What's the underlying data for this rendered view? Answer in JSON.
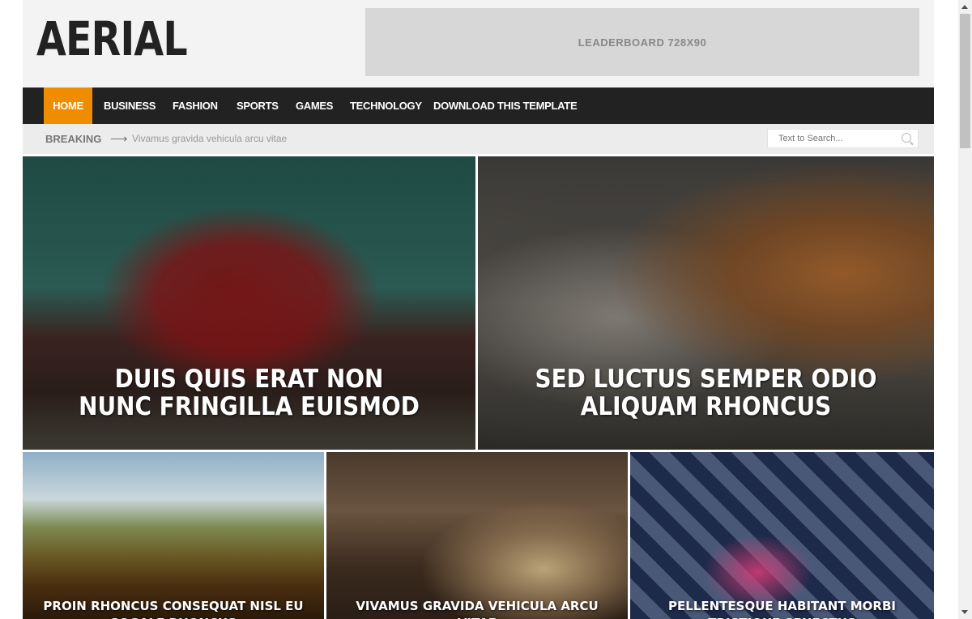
{
  "header": {
    "logo": "AERIAL",
    "leaderboard": "LEADERBOARD 728X90"
  },
  "nav": {
    "items": [
      {
        "label": "HOME",
        "active": true
      },
      {
        "label": "BUSINESS"
      },
      {
        "label": "FASHION"
      },
      {
        "label": "SPORTS"
      },
      {
        "label": "GAMES"
      },
      {
        "label": "TECHNOLOGY"
      },
      {
        "label": "DOWNLOAD THIS TEMPLATE"
      }
    ]
  },
  "breaking": {
    "label": "BREAKING",
    "arrow": "⟶",
    "text": "Vivamus gravida vehicula arcu vitae"
  },
  "search": {
    "placeholder": "Text to Search..."
  },
  "posts": [
    {
      "title": "DUIS QUIS ERAT NON NUNC FRINGILLA EUISMOD"
    },
    {
      "title": "SED LUCTUS SEMPER ODIO ALIQUAM RHONCUS"
    },
    {
      "title": "PROIN RHONCUS CONSEQUAT NISL EU SOGALE RHONCUS"
    },
    {
      "title": "VIVAMUS GRAVIDA VEHICULA ARCU VITAE"
    },
    {
      "title": "PELLENTESQUE HABITANT MORBI TRISTIQUE SENECTUS"
    }
  ],
  "colors": {
    "accent": "#ef8c00",
    "nav_bg": "#222222",
    "header_bg": "#f3f3f3"
  }
}
